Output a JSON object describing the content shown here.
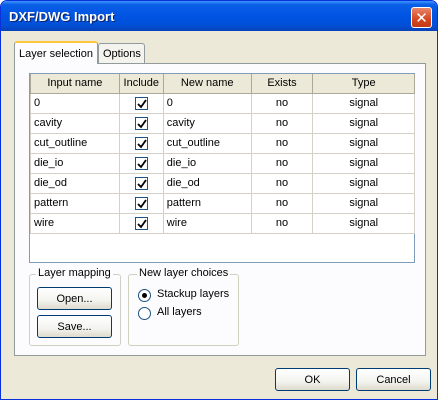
{
  "window": {
    "title": "DXF/DWG Import",
    "close_glyph": "✕"
  },
  "tabs": [
    {
      "label": "Layer selection",
      "active": true
    },
    {
      "label": "Options",
      "active": false
    }
  ],
  "table": {
    "headers": [
      "Input name",
      "Include",
      "New name",
      "Exists",
      "Type"
    ],
    "rows": [
      {
        "input": "0",
        "include": true,
        "new_name": "0",
        "exists": "no",
        "type": "signal"
      },
      {
        "input": "cavity",
        "include": true,
        "new_name": "cavity",
        "exists": "no",
        "type": "signal"
      },
      {
        "input": "cut_outline",
        "include": true,
        "new_name": "cut_outline",
        "exists": "no",
        "type": "signal"
      },
      {
        "input": "die_io",
        "include": true,
        "new_name": "die_io",
        "exists": "no",
        "type": "signal"
      },
      {
        "input": "die_od",
        "include": true,
        "new_name": "die_od",
        "exists": "no",
        "type": "signal"
      },
      {
        "input": "pattern",
        "include": true,
        "new_name": "pattern",
        "exists": "no",
        "type": "signal"
      },
      {
        "input": "wire",
        "include": true,
        "new_name": "wire",
        "exists": "no",
        "type": "signal"
      }
    ]
  },
  "layer_mapping": {
    "legend": "Layer mapping",
    "open_label": "Open...",
    "save_label": "Save..."
  },
  "new_layer_choices": {
    "legend": "New layer choices",
    "options": [
      {
        "label": "Stackup layers",
        "selected": true
      },
      {
        "label": "All layers",
        "selected": false
      }
    ]
  },
  "footer": {
    "ok_label": "OK",
    "cancel_label": "Cancel"
  },
  "colors": {
    "titlebar": "#0054e3",
    "face": "#ece9d8",
    "panel": "#fcfcfe",
    "tab_highlight": "#ffc83c",
    "close": "#d6461f"
  }
}
